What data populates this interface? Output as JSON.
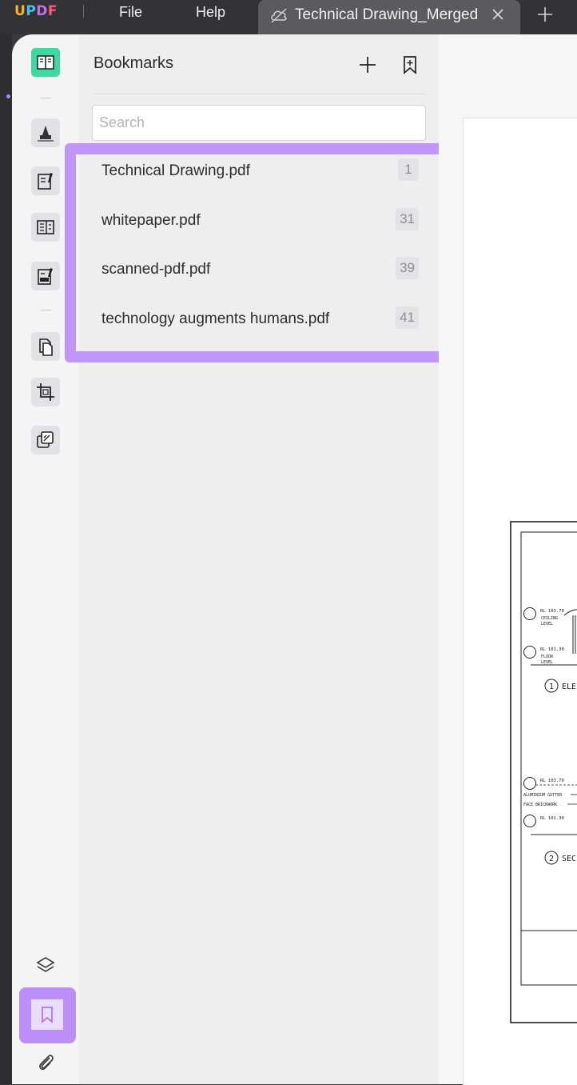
{
  "app": {
    "logo": {
      "u": "U",
      "p": "P",
      "d": "D",
      "f": "F"
    },
    "menu": {
      "file": "File",
      "help": "Help"
    },
    "tab": {
      "title": "Technical Drawing_Merged"
    }
  },
  "bookmarks": {
    "title": "Bookmarks",
    "search_placeholder": "Search",
    "items": [
      {
        "label": "Technical Drawing.pdf",
        "page": "1"
      },
      {
        "label": "whitepaper.pdf",
        "page": "31"
      },
      {
        "label": "scanned-pdf.pdf",
        "page": "39"
      },
      {
        "label": "technology augments humans.pdf",
        "page": "41"
      }
    ]
  },
  "drawing": {
    "rl1": "RL 103.70",
    "ceiling": "CEILING",
    "level": "LEVEL",
    "rl2": "RL 101.30",
    "floor": "FLOOR",
    "label1": "1",
    "elev": "ELE",
    "rl3": "RL 103.70",
    "gutter": "ALUMINIUM GUTTER",
    "brick": "FACE BRICKWORK",
    "rl4": "RL 101.30",
    "label2": "2",
    "sec": "SEC"
  },
  "colors": {
    "accent": "#bc8ef7",
    "active_tool": "#3fd8a0"
  }
}
